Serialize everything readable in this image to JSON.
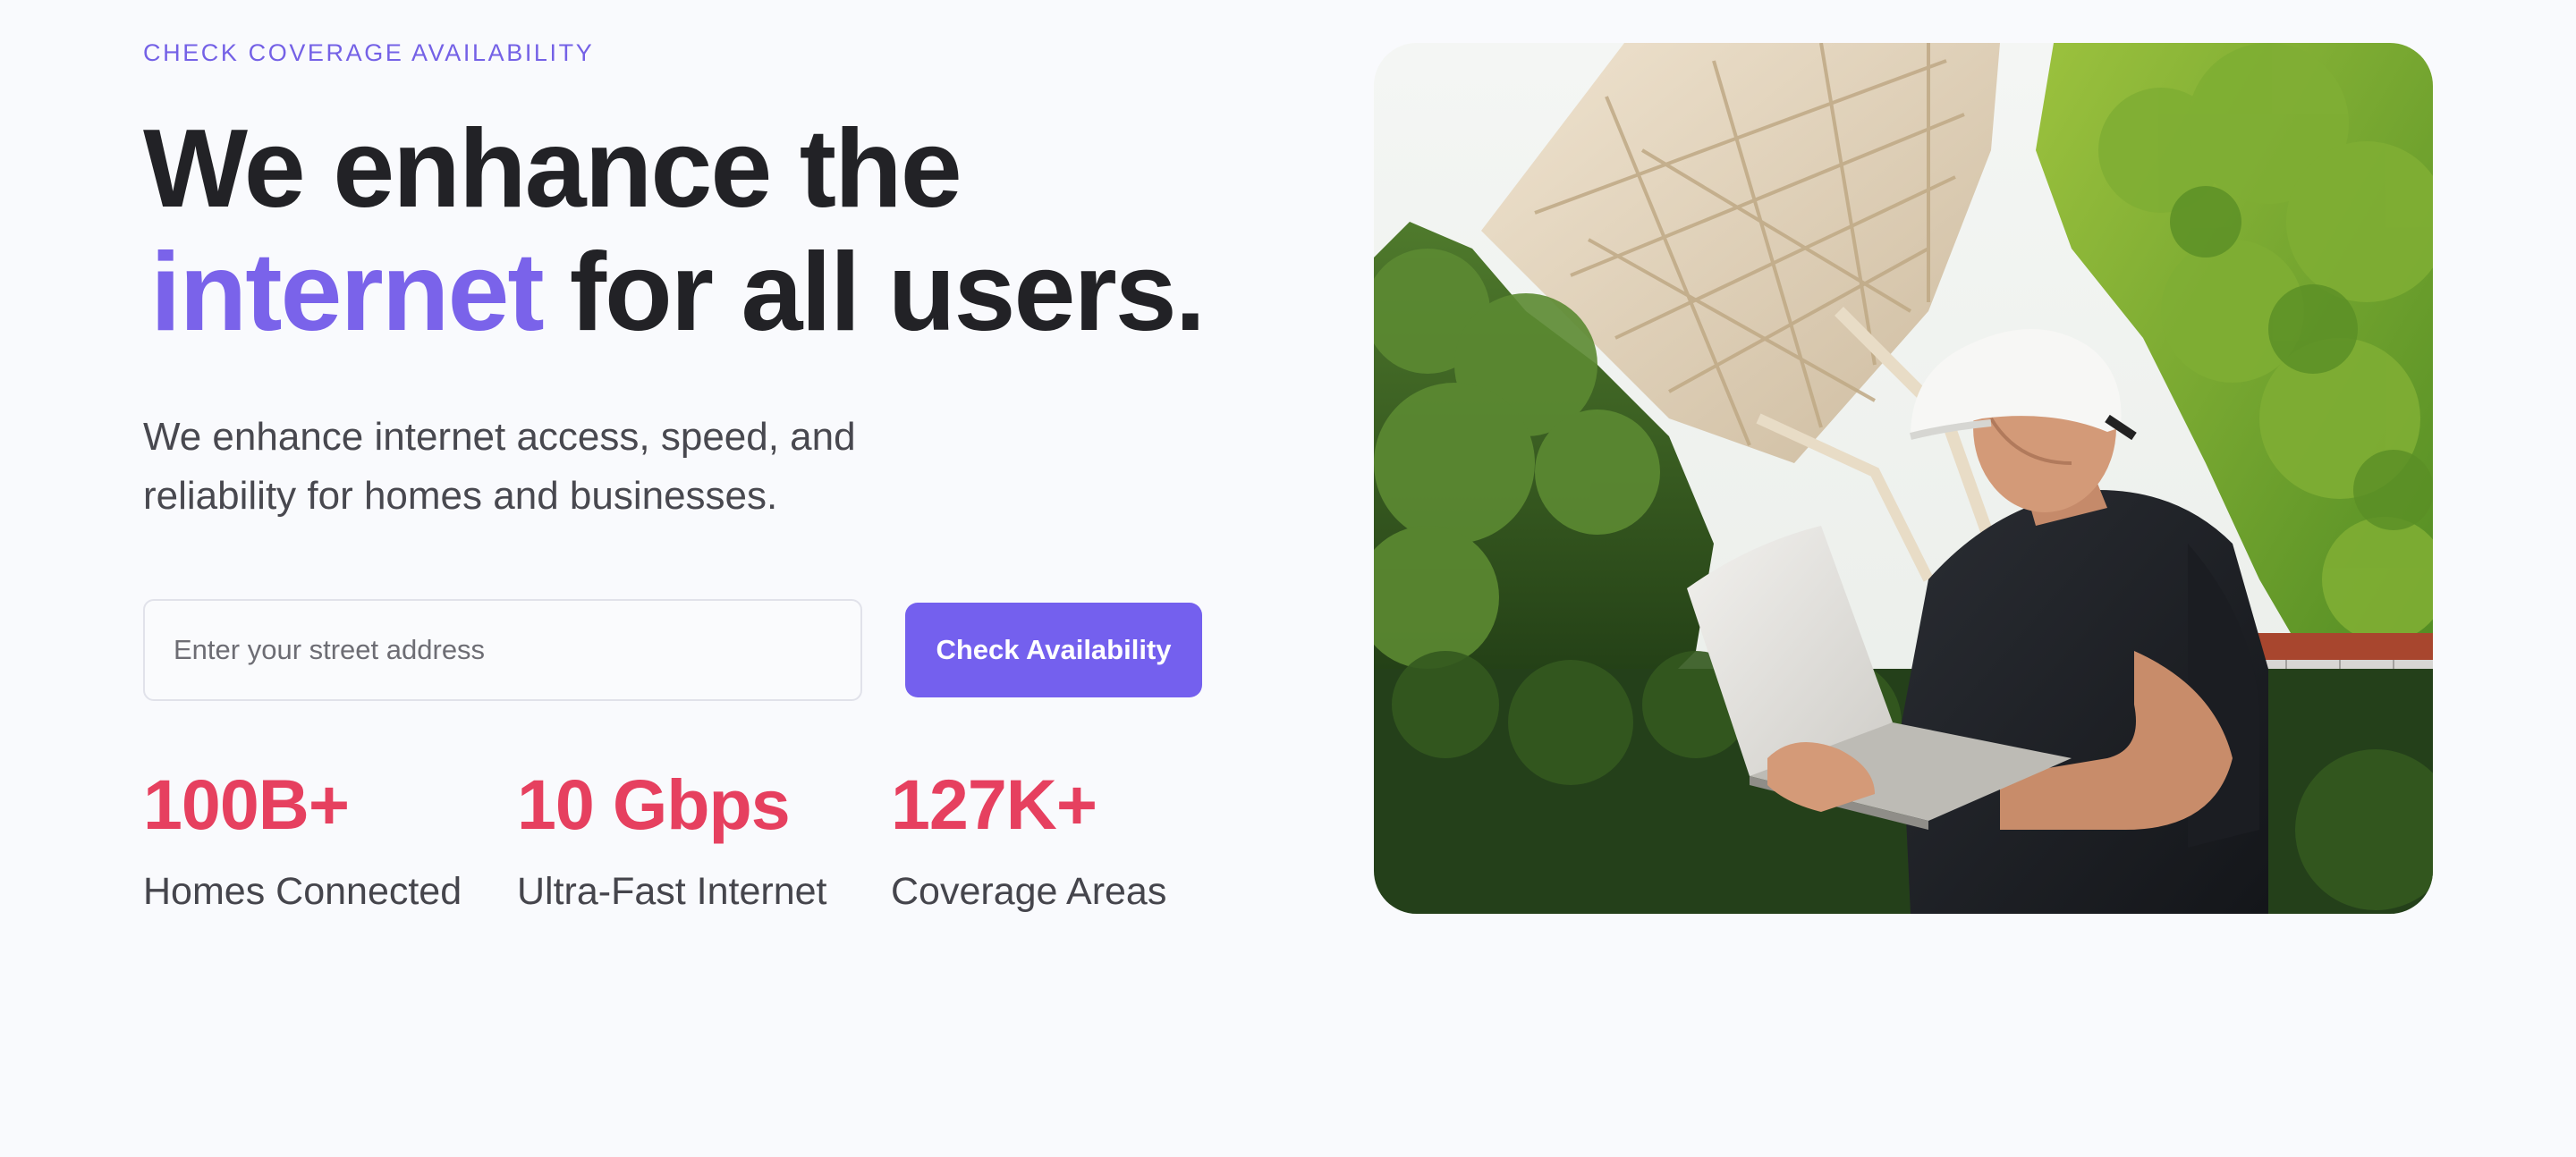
{
  "hero": {
    "eyebrow": "CHECK COVERAGE AVAILABILITY",
    "headline_line1": "We enhance the",
    "headline_accent": "internet",
    "headline_rest": "for all users.",
    "subcopy": "We enhance internet access, speed, and reliability for homes and businesses."
  },
  "form": {
    "address_placeholder": "Enter your street address",
    "address_value": "",
    "submit_label": "Check Availability"
  },
  "stats": [
    {
      "value": "100B+",
      "label": "Homes Connected"
    },
    {
      "value": "10 Gbps",
      "label": "Ultra-Fast Internet"
    },
    {
      "value": "127K+",
      "label": "Coverage Areas"
    }
  ],
  "image": {
    "subject": "technician-with-laptop-near-satellite-dish"
  },
  "colors": {
    "accent_purple": "#7a63ea",
    "button_purple": "#7460ee",
    "stat_red": "#e6405f",
    "heading_dark": "#222226",
    "background": "#f9fafd"
  }
}
